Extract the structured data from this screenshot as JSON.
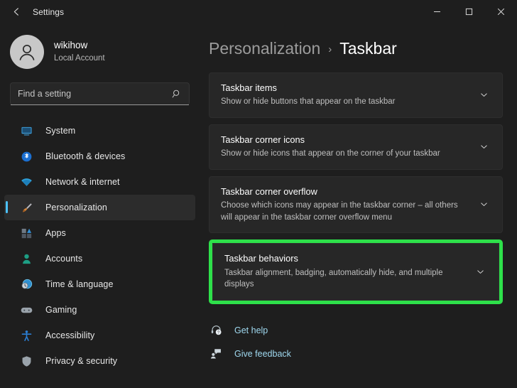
{
  "window": {
    "title": "Settings",
    "back_icon": "back-arrow-icon",
    "controls": {
      "minimize": "minimize-icon",
      "maximize": "maximize-icon",
      "close": "close-icon"
    }
  },
  "account": {
    "name": "wikihow",
    "type": "Local Account",
    "avatar_icon": "user-avatar-icon"
  },
  "search": {
    "placeholder": "Find a setting",
    "value": "",
    "icon": "search-icon"
  },
  "sidebar": {
    "items": [
      {
        "label": "System",
        "icon": "monitor-icon",
        "active": false
      },
      {
        "label": "Bluetooth & devices",
        "icon": "bluetooth-icon",
        "active": false
      },
      {
        "label": "Network & internet",
        "icon": "wifi-icon",
        "active": false
      },
      {
        "label": "Personalization",
        "icon": "paintbrush-icon",
        "active": true
      },
      {
        "label": "Apps",
        "icon": "apps-grid-icon",
        "active": false
      },
      {
        "label": "Accounts",
        "icon": "person-icon",
        "active": false
      },
      {
        "label": "Time & language",
        "icon": "clock-globe-icon",
        "active": false
      },
      {
        "label": "Gaming",
        "icon": "gamepad-icon",
        "active": false
      },
      {
        "label": "Accessibility",
        "icon": "accessibility-person-icon",
        "active": false
      },
      {
        "label": "Privacy & security",
        "icon": "shield-icon",
        "active": false
      }
    ]
  },
  "main": {
    "breadcrumb": {
      "parent": "Personalization",
      "separator": "›",
      "current": "Taskbar"
    },
    "cards": [
      {
        "title": "Taskbar items",
        "subtitle": "Show or hide buttons that appear on the taskbar",
        "chevron": "chevron-down-icon",
        "highlighted": false
      },
      {
        "title": "Taskbar corner icons",
        "subtitle": "Show or hide icons that appear on the corner of your taskbar",
        "chevron": "chevron-down-icon",
        "highlighted": false
      },
      {
        "title": "Taskbar corner overflow",
        "subtitle": "Choose which icons may appear in the taskbar corner – all others will appear in the taskbar corner overflow menu",
        "chevron": "chevron-down-icon",
        "highlighted": false
      },
      {
        "title": "Taskbar behaviors",
        "subtitle": "Taskbar alignment, badging, automatically hide, and multiple displays",
        "chevron": "chevron-down-icon",
        "highlighted": true
      }
    ],
    "links": [
      {
        "label": "Get help",
        "icon": "help-headset-icon"
      },
      {
        "label": "Give feedback",
        "icon": "feedback-person-icon"
      }
    ]
  },
  "colors": {
    "accent": "#4cc2ff",
    "highlight": "#2ee04a",
    "link": "#9fd8ef",
    "background": "#1e1e1e",
    "card": "#272727"
  }
}
